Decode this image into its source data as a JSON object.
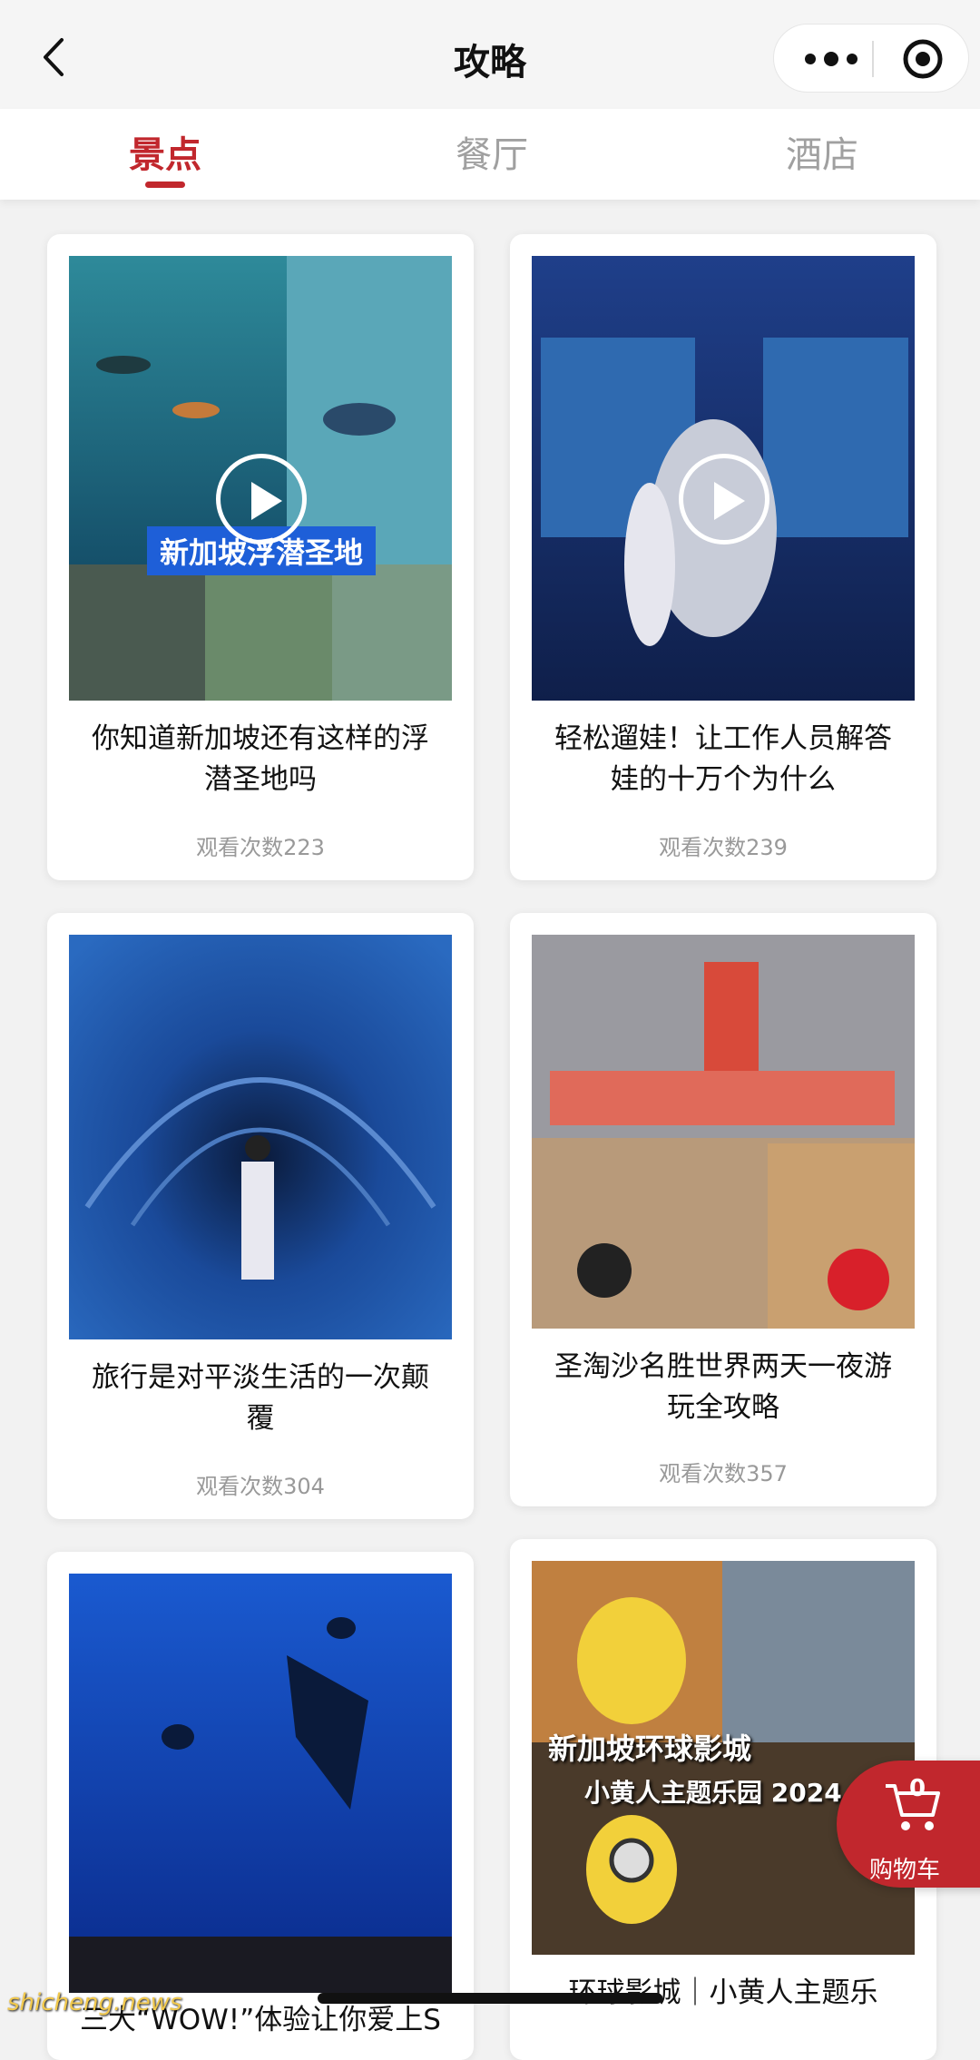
{
  "header": {
    "title": "攻略"
  },
  "tabs": [
    {
      "label": "景点",
      "active": true
    },
    {
      "label": "餐厅",
      "active": false
    },
    {
      "label": "酒店",
      "active": false
    }
  ],
  "cards": [
    {
      "title_line1": "你知道新加坡还有这样的浮",
      "title_line2": "潜圣地吗",
      "views": "观看次数223",
      "has_video": true,
      "overlay_text": "新加坡浮潜圣地"
    },
    {
      "title_line1": "轻松遛娃！让工作人员解答",
      "title_line2": "娃的十万个为什么",
      "views": "观看次数239",
      "has_video": true
    },
    {
      "title_line1": "旅行是对平淡生活的一次颠",
      "title_line2": "覆",
      "views": "观看次数304",
      "has_video": false
    },
    {
      "title_line1": "圣淘沙名胜世界两天一夜游",
      "title_line2": "玩全攻略",
      "views": "观看次数357",
      "has_video": false
    },
    {
      "title_line1": "三大“WOW!”体验让你爱上S",
      "views": "",
      "has_video": false
    },
    {
      "title_line1": "环球影城｜小黄人主题乐",
      "views": "",
      "has_video": false,
      "overlay_text": "新加坡环球影城",
      "overlay_text2": "小黄人主题乐园 2024"
    }
  ],
  "cart": {
    "count": "0",
    "label": "购物车"
  },
  "watermark": "shicheng.news",
  "colors": {
    "accent": "#c1272d",
    "banner": "#1e5fd8"
  }
}
